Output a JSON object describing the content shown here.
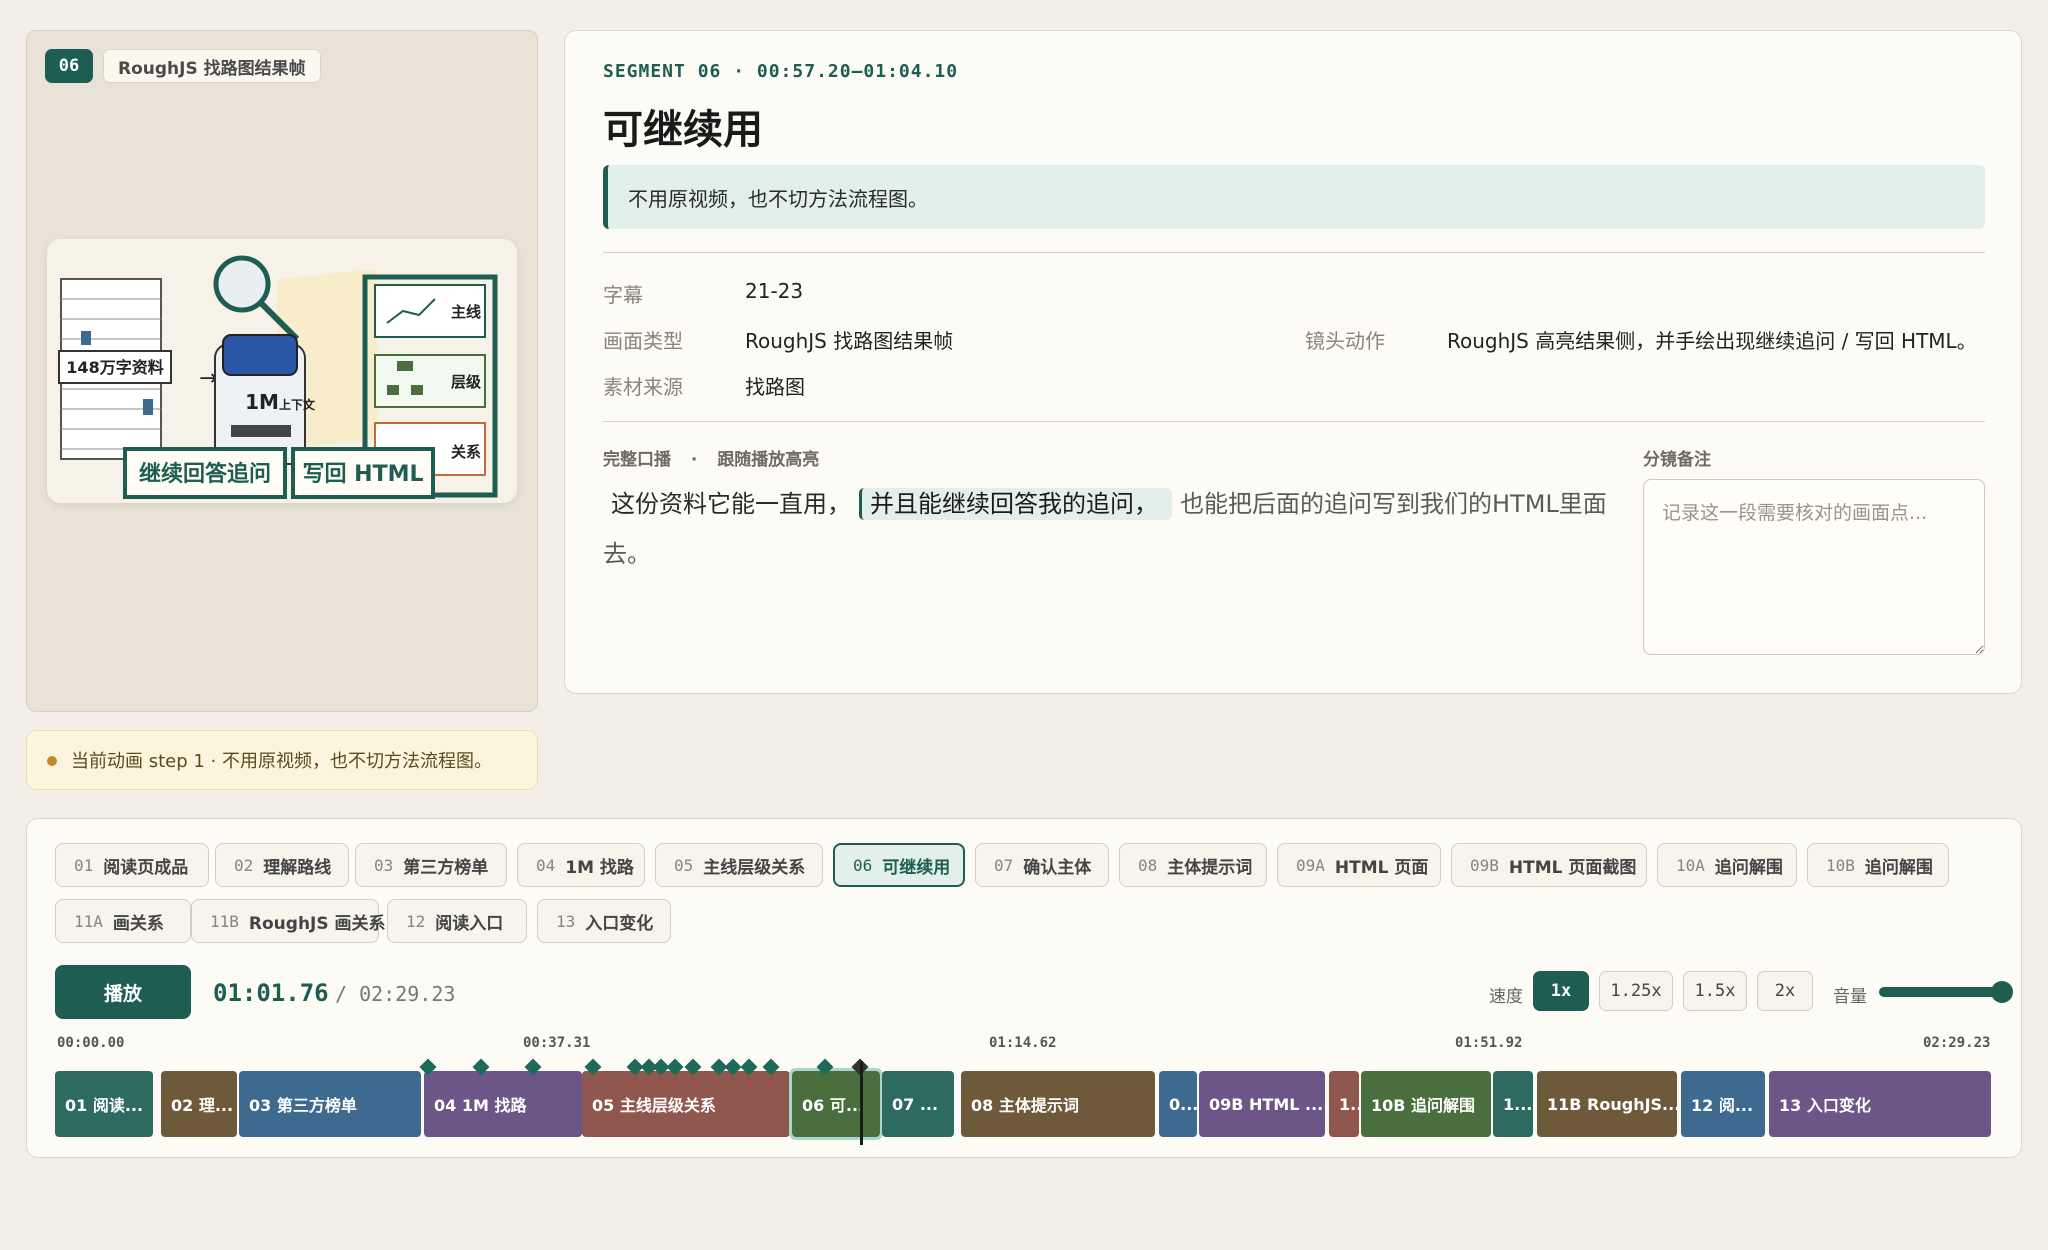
{
  "preview": {
    "seg_num": "06",
    "scene_tag": "RoughJS 找路图结果帧",
    "frame": {
      "docs_label": "148万字资料",
      "ctx_big": "1M",
      "ctx_small": "上下文",
      "card1": "主线",
      "card2": "层级",
      "card3": "关系",
      "banner1": "继续回答追问",
      "banner2": "写回 HTML"
    }
  },
  "anim_note": "当前动画 step 1 · 不用原视频，也不切方法流程图。",
  "detail": {
    "meta": "SEGMENT 06 · 00:57.20–01:04.10",
    "title": "可继续用",
    "callout": "不用原视频，也不切方法流程图。",
    "rows": {
      "subtitle_label": "字幕",
      "subtitle_value": "21-23",
      "type_label": "画面类型",
      "type_value": "RoughJS 找路图结果帧",
      "camera_label": "镜头动作",
      "camera_value": "RoughJS 高亮结果侧，并手绘出现继续追问 / 写回 HTML。",
      "source_label": "素材来源",
      "source_value": "找路图"
    },
    "transcript_label": "完整口播",
    "transcript_sep": "·",
    "transcript_mode": "跟随播放高亮",
    "transcript": {
      "before": "这份资料它能一直用，",
      "highlight": "并且能继续回答我的追问，",
      "after": "也能把后面的追问写到我们的HTML里面去。"
    },
    "notes_label": "分镜备注",
    "notes_placeholder": "记录这一段需要核对的画面点..."
  },
  "chips": [
    {
      "id": "01",
      "name": "阅读页成品"
    },
    {
      "id": "02",
      "name": "理解路线"
    },
    {
      "id": "03",
      "name": "第三方榜单"
    },
    {
      "id": "04",
      "name": "1M 找路"
    },
    {
      "id": "05",
      "name": "主线层级关系"
    },
    {
      "id": "06",
      "name": "可继续用",
      "active": true
    },
    {
      "id": "07",
      "name": "确认主体"
    },
    {
      "id": "08",
      "name": "主体提示词"
    },
    {
      "id": "09A",
      "name": "HTML 页面"
    },
    {
      "id": "09B",
      "name": "HTML 页面截图"
    },
    {
      "id": "10A",
      "name": "追问解围"
    },
    {
      "id": "10B",
      "name": "追问解围"
    },
    {
      "id": "11A",
      "name": "画关系"
    },
    {
      "id": "11B",
      "name": "RoughJS 画关系"
    },
    {
      "id": "12",
      "name": "阅读入口"
    },
    {
      "id": "13",
      "name": "入口变化"
    }
  ],
  "player": {
    "play_label": "播放",
    "current": "01:01.76",
    "total": "/ 02:29.23",
    "speed_label": "速度",
    "speeds": [
      "1x",
      "1.25x",
      "1.5x",
      "2x"
    ],
    "active_speed": "1x",
    "volume_label": "音量",
    "volume": 1.0
  },
  "timeline": {
    "total_seconds": 149.23,
    "current_seconds": 61.76,
    "ticks": [
      "00:00.00",
      "00:37.31",
      "01:14.62",
      "01:51.92",
      "02:29.23"
    ],
    "blocks": [
      {
        "label": "01 阅读...",
        "color": "#2d6b60"
      },
      {
        "label": "02 理...",
        "color": "#6e5a3a"
      },
      {
        "label": "03 第三方榜单",
        "color": "#3f6a8f"
      },
      {
        "label": "04 1M 找路",
        "color": "#6c5688"
      },
      {
        "label": "05 主线层级关系",
        "color": "#8f574d"
      },
      {
        "label": "06 可...",
        "color": "#4a6e3e",
        "active": true
      },
      {
        "label": "07 ...",
        "color": "#2d6b60"
      },
      {
        "label": "08 主体提示词",
        "color": "#6e5a3a"
      },
      {
        "label": "0...",
        "color": "#3f6a8f"
      },
      {
        "label": "09B HTML ...",
        "color": "#6c5688"
      },
      {
        "label": "1...",
        "color": "#8f574d"
      },
      {
        "label": "10B 追问解围",
        "color": "#4a6e3e"
      },
      {
        "label": "1...",
        "color": "#2d6b60"
      },
      {
        "label": "11B RoughJS...",
        "color": "#6e5a3a"
      },
      {
        "label": "12 阅...",
        "color": "#3f6a8f"
      },
      {
        "label": "13 入口变化",
        "color": "#6c5688"
      }
    ]
  }
}
